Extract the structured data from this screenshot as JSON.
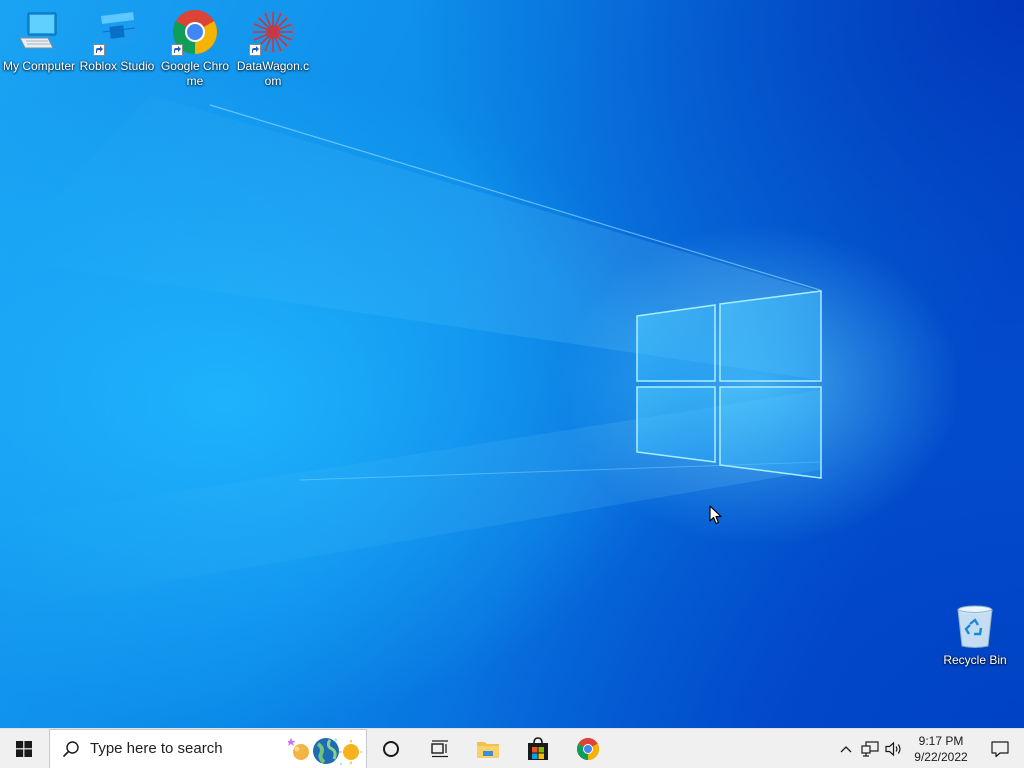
{
  "desktop": {
    "icons": [
      {
        "label": "My Computer",
        "icon": "computer-icon",
        "shortcut": false
      },
      {
        "label": "Roblox Studio",
        "icon": "roblox-studio-icon",
        "shortcut": true
      },
      {
        "label": "Google Chrome",
        "icon": "chrome-icon",
        "shortcut": true
      },
      {
        "label": "DataWagon.com",
        "icon": "datawagon-icon",
        "shortcut": true
      }
    ],
    "recycle_bin": {
      "label": "Recycle Bin",
      "icon": "recycle-bin-icon"
    }
  },
  "taskbar": {
    "start_icon": "windows-start-icon",
    "search": {
      "placeholder": "Type here to search",
      "icon": "search-icon"
    },
    "cortana_icon": "cortana-icon",
    "task_view_icon": "task-view-icon",
    "pinned": [
      {
        "name": "File Explorer",
        "icon": "file-explorer-icon"
      },
      {
        "name": "Microsoft Store",
        "icon": "microsoft-store-icon"
      },
      {
        "name": "Google Chrome",
        "icon": "chrome-icon"
      }
    ],
    "tray": {
      "chevron_icon": "chevron-up-icon",
      "network_icon": "network-icon",
      "volume_icon": "volume-icon",
      "time": "9:17 PM",
      "date": "9/22/2022",
      "notification_icon": "action-center-icon"
    }
  },
  "colors": {
    "wallpaper_light": "#29b6ff",
    "wallpaper_mid": "#0b84e6",
    "wallpaper_dark": "#0047c9",
    "taskbar": "#f0f0f0",
    "chrome_red": "#db4437",
    "chrome_green": "#0f9d58",
    "chrome_yellow": "#f4b400",
    "chrome_blue": "#4285f4"
  }
}
